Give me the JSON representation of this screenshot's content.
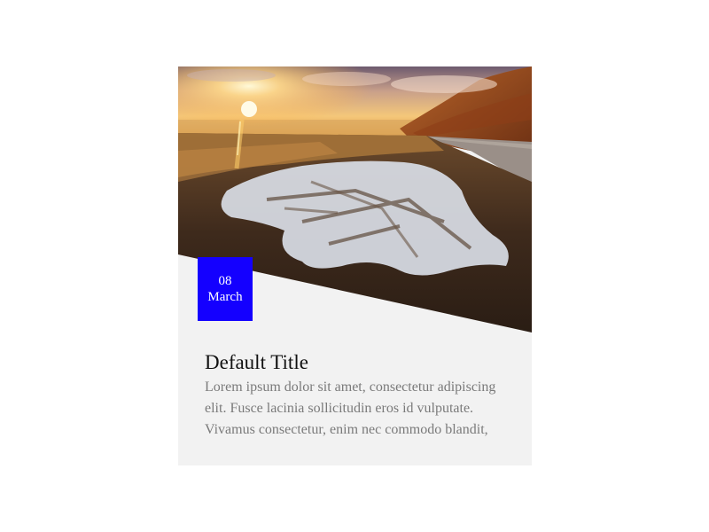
{
  "card": {
    "image_alt": "Sunset over a dirt roadside with melting snow and a hillside road",
    "date": {
      "day": "08",
      "month": "March"
    },
    "title": "Default Title",
    "text": "Lorem ipsum dolor sit amet, consectetur adipiscing elit. Fusce lacinia sollicitudin eros id vulputate. Vivamus consectetur, enim nec commodo blandit,"
  },
  "colors": {
    "badge": "#1400ff",
    "card_background": "#f2f2f2",
    "body_text": "#7a7a7a"
  }
}
